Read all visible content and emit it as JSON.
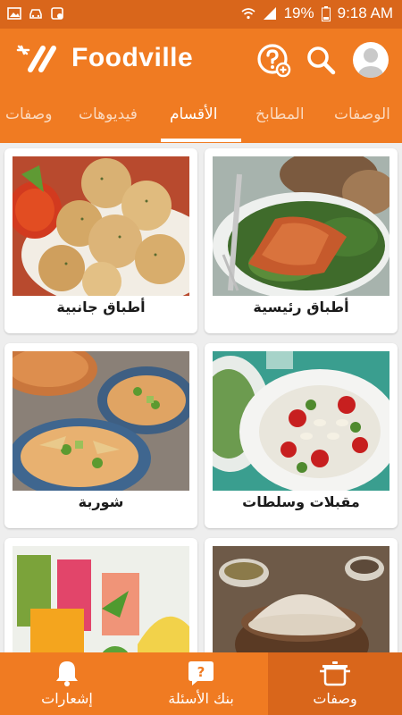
{
  "status_bar": {
    "battery": "19%",
    "time": "9:18 AM"
  },
  "app_bar": {
    "brand": "Foodville",
    "help_icon": "question-plus-icon",
    "search_icon": "search-icon",
    "profile_icon": "avatar-icon"
  },
  "tabs": {
    "items": [
      "الوصفات",
      "المطابخ",
      "الأقسام",
      "فيديوهات",
      "وصفات"
    ],
    "active": "الأقسام"
  },
  "categories": [
    {
      "label": "أطباق رئيسية",
      "image": "salmon-salad-photo"
    },
    {
      "label": "أطباق جانبية",
      "image": "garlic-knots-photo"
    },
    {
      "label": "مقبلات وسلطات",
      "image": "bean-tomato-salad-photo"
    },
    {
      "label": "شوربة",
      "image": "tortilla-soup-photo"
    },
    {
      "label": "",
      "image": "flour-bowls-photo"
    },
    {
      "label": "",
      "image": "fruit-juices-photo"
    }
  ],
  "bottom_nav": {
    "items": [
      {
        "label": "وصفات",
        "icon": "pot-icon",
        "active": true
      },
      {
        "label": "بنك الأسئلة",
        "icon": "question-bubble-icon",
        "active": false
      },
      {
        "label": "إشعارات",
        "icon": "bell-icon",
        "active": false
      }
    ]
  },
  "colors": {
    "primary": "#f07b22",
    "primary_dark": "#d9661b",
    "background": "#eeeeee"
  }
}
